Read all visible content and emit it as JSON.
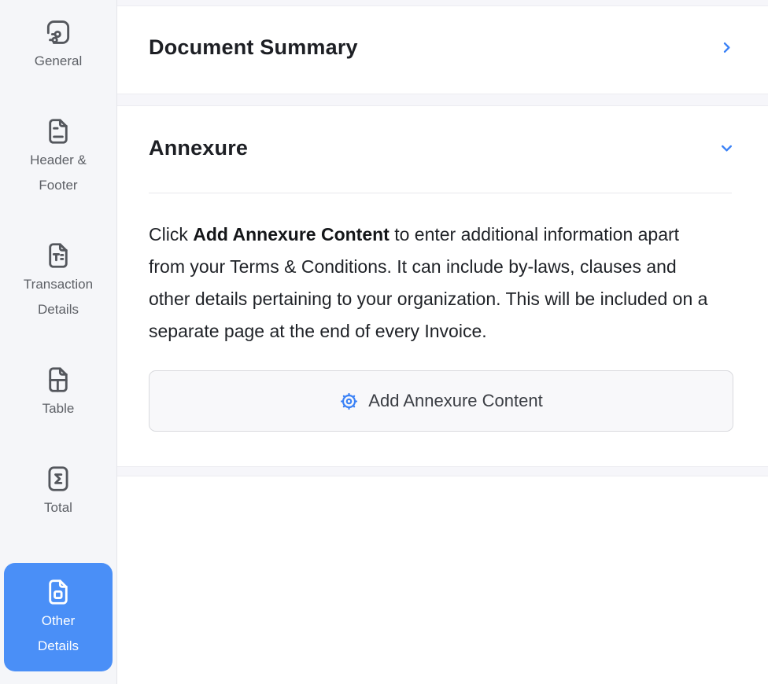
{
  "colors": {
    "accent": "#3b82f6",
    "selected_item_bg": "#4a8ff7",
    "sidebar_bg": "#f5f6f9",
    "section_band_bg": "#f6f6fa"
  },
  "sidebar": {
    "items": [
      {
        "label": "General",
        "icon": "general-icon",
        "selected": false
      },
      {
        "label": "Header & Footer",
        "icon": "header-footer-icon",
        "selected": false
      },
      {
        "label": "Transaction Details",
        "icon": "transaction-details-icon",
        "selected": false
      },
      {
        "label": "Table",
        "icon": "table-icon",
        "selected": false
      },
      {
        "label": "Total",
        "icon": "total-icon",
        "selected": false
      },
      {
        "label": "Other Details",
        "icon": "other-details-icon",
        "selected": true
      }
    ]
  },
  "main": {
    "sections": [
      {
        "title": "Document Summary",
        "state": "collapsed",
        "chevron": "chevron-right-icon"
      },
      {
        "title": "Annexure",
        "state": "expanded",
        "chevron": "chevron-down-icon"
      }
    ],
    "annexure": {
      "description_prefix": "Click ",
      "description_bold": "Add Annexure Content",
      "description_suffix": " to enter additional information apart from your Terms & Conditions. It can include by-laws, clauses and other details pertaining to your organization. This will be included on a separate page at the end of every Invoice.",
      "button_label": "Add Annexure Content",
      "button_icon": "gear-icon"
    }
  }
}
